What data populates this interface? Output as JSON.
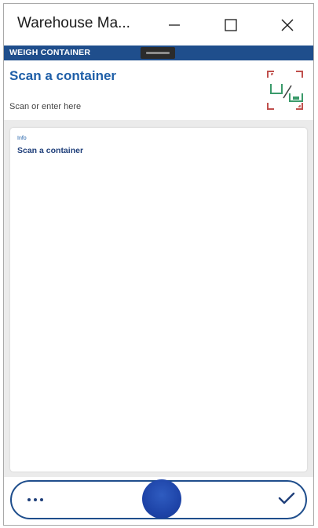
{
  "window": {
    "title": "Warehouse Ma...",
    "controls": {
      "minimize_icon": "minimize-icon",
      "maximize_icon": "maximize-icon",
      "close_icon": "close-icon"
    }
  },
  "header": {
    "label": "WEIGH CONTAINER"
  },
  "scan": {
    "heading": "Scan a container",
    "placeholder": "Scan or enter here",
    "value": "",
    "icon": "scan-barcode-icon"
  },
  "info": {
    "label": "Info",
    "message": "Scan a container"
  },
  "actions": {
    "more_icon": "more-dots-icon",
    "confirm_icon": "checkmark-icon"
  },
  "colors": {
    "brand_blue": "#1f4e8c",
    "heading_blue": "#1f5fa8",
    "center_button_blue": "#1e44a8",
    "scan_icon_green": "#3a9a6a",
    "scan_icon_red": "#c0504d"
  }
}
